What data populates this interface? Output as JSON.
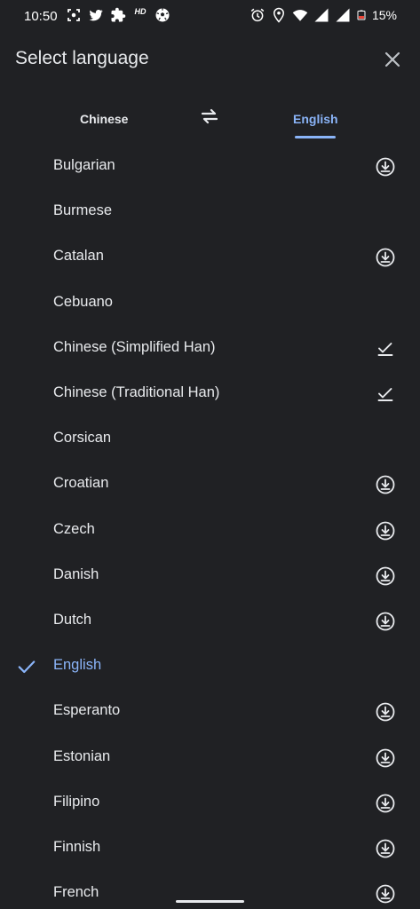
{
  "status_bar": {
    "time": "10:50",
    "hd_label": "HD",
    "battery_percent": "15%",
    "left_icons": [
      "screenshot-icon",
      "twitter-icon",
      "puzzle-icon",
      "hd-icon",
      "soccer-ball-icon"
    ],
    "right_icons": [
      "alarm-icon",
      "location-icon",
      "wifi-icon",
      "signal-icon",
      "signal-icon",
      "battery-icon"
    ],
    "battery_color": "#ea4335"
  },
  "header": {
    "title": "Select language",
    "close_icon": "close-icon"
  },
  "tabs": {
    "source": "Chinese",
    "target": "English",
    "swap_icon": "swap-icon",
    "active_color": "#8ab4f8"
  },
  "languages": [
    {
      "name": "Bulgarian",
      "status": "download"
    },
    {
      "name": "Burmese",
      "status": "none"
    },
    {
      "name": "Catalan",
      "status": "download"
    },
    {
      "name": "Cebuano",
      "status": "none"
    },
    {
      "name": "Chinese (Simplified Han)",
      "status": "downloaded"
    },
    {
      "name": "Chinese (Traditional Han)",
      "status": "downloaded"
    },
    {
      "name": "Corsican",
      "status": "none"
    },
    {
      "name": "Croatian",
      "status": "download"
    },
    {
      "name": "Czech",
      "status": "download"
    },
    {
      "name": "Danish",
      "status": "download"
    },
    {
      "name": "Dutch",
      "status": "download"
    },
    {
      "name": "English",
      "status": "none",
      "selected": true
    },
    {
      "name": "Esperanto",
      "status": "download"
    },
    {
      "name": "Estonian",
      "status": "download"
    },
    {
      "name": "Filipino",
      "status": "download"
    },
    {
      "name": "Finnish",
      "status": "download"
    },
    {
      "name": "French",
      "status": "download"
    }
  ],
  "colors": {
    "background": "#202124",
    "text": "#e8eaed",
    "accent": "#8ab4f8"
  }
}
